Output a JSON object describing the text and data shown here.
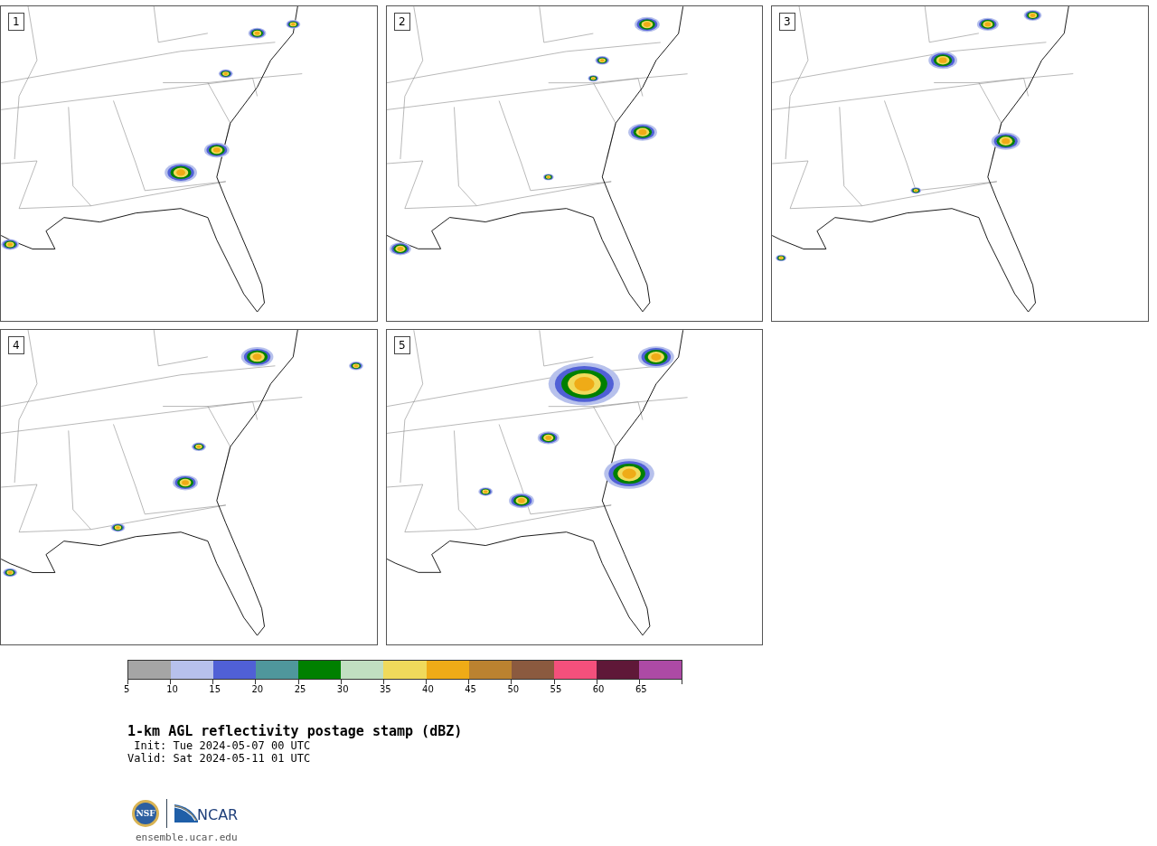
{
  "panels": [
    {
      "label": "1"
    },
    {
      "label": "2"
    },
    {
      "label": "3"
    },
    {
      "label": "4"
    },
    {
      "label": "5"
    }
  ],
  "colorbar": {
    "bins": [
      {
        "color": "#a5a5a5",
        "tick": "5"
      },
      {
        "color": "#b7c1ec",
        "tick": "10"
      },
      {
        "color": "#5060d6",
        "tick": "15"
      },
      {
        "color": "#4f979c",
        "tick": "20"
      },
      {
        "color": "#008000",
        "tick": "25"
      },
      {
        "color": "#c1dfc1",
        "tick": "30"
      },
      {
        "color": "#f0da5b",
        "tick": "35"
      },
      {
        "color": "#efab17",
        "tick": "40"
      },
      {
        "color": "#bb8230",
        "tick": "45"
      },
      {
        "color": "#8b5a3f",
        "tick": "50"
      },
      {
        "color": "#f4507c",
        "tick": "55"
      },
      {
        "color": "#5f1838",
        "tick": "60"
      },
      {
        "color": "#ad4aa5",
        "tick": "65"
      }
    ]
  },
  "title": "1-km AGL reflectivity postage stamp (dBZ)",
  "init": " Init: Tue 2024-05-07 00 UTC",
  "valid": "Valid: Sat 2024-05-11 01 UTC",
  "logo": {
    "nsf": "NSF",
    "ncar": "NCAR"
  },
  "url": "ensemble.ucar.edu"
}
